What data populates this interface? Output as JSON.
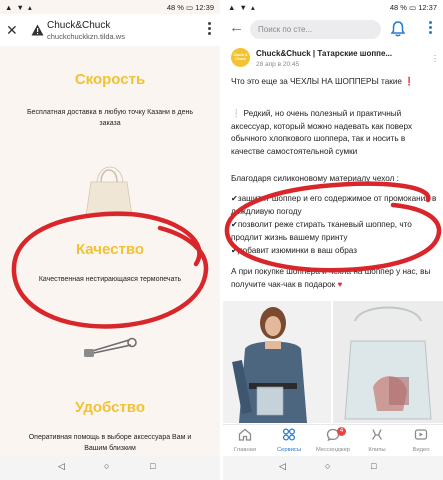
{
  "left_phone": {
    "status": {
      "left": "▲  ▼ ▴",
      "right": "48 %  ▭ 12:39"
    },
    "browser": {
      "title": "Chuck&Chuck",
      "url": "chuckchuckkzn.tilda.ws"
    },
    "sections": {
      "speed": {
        "heading": "Скорость",
        "text": "Бесплатная доставка в любую точку Казани в день заказа"
      },
      "quality": {
        "heading": "Качество",
        "text": "Качественная нестирающаяся термопечать"
      },
      "comfort": {
        "heading": "Удобство",
        "text": "Оперативная помощь в выборе аксессуара Вам и Вашим близким"
      }
    }
  },
  "right_phone": {
    "status": {
      "left": "▲  ▼ ▴",
      "right": "48 %  ▭ 12:37"
    },
    "search": {
      "placeholder": "Поиск по сте..."
    },
    "post": {
      "avatar_text": "Chuck & Chuck",
      "author": "Chuck&Chuck | Татарские шоппе...",
      "date": "28 апр в 20:45",
      "paragraphs": [
        "Что это еще за ЧЕХЛЫ НА ШОППЕРЫ такие",
        "Редкий, но очень полезный и практичный аксессуар, который можно надевать как поверх обычного хлопкового шоппера, так и носить в качестве самостоятельной сумки",
        "Благодаря силиконовому материалу чехол :",
        "✔защитит шоппер и его содержимое от промокания в дождливую погоду",
        "✔позволит реже стирать тканевый шоппер, что продлит жизнь вашему принту",
        "✔добавит изюминки в ваш образ",
        "А при покупке шоппера и чехла на шоппер у нас, вы получите чак-чак в подарок"
      ]
    },
    "tabs": [
      {
        "label": "Главная",
        "icon": "home-icon"
      },
      {
        "label": "Сервисы",
        "icon": "services-icon"
      },
      {
        "label": "Мессенджер",
        "icon": "messenger-icon",
        "badge": "4"
      },
      {
        "label": "Клипы",
        "icon": "clips-icon"
      },
      {
        "label": "Видео",
        "icon": "video-icon"
      }
    ]
  },
  "colors": {
    "accent_yellow": "#f2c230",
    "circle_red": "#d8262a",
    "vk_blue": "#2a7ad2"
  }
}
